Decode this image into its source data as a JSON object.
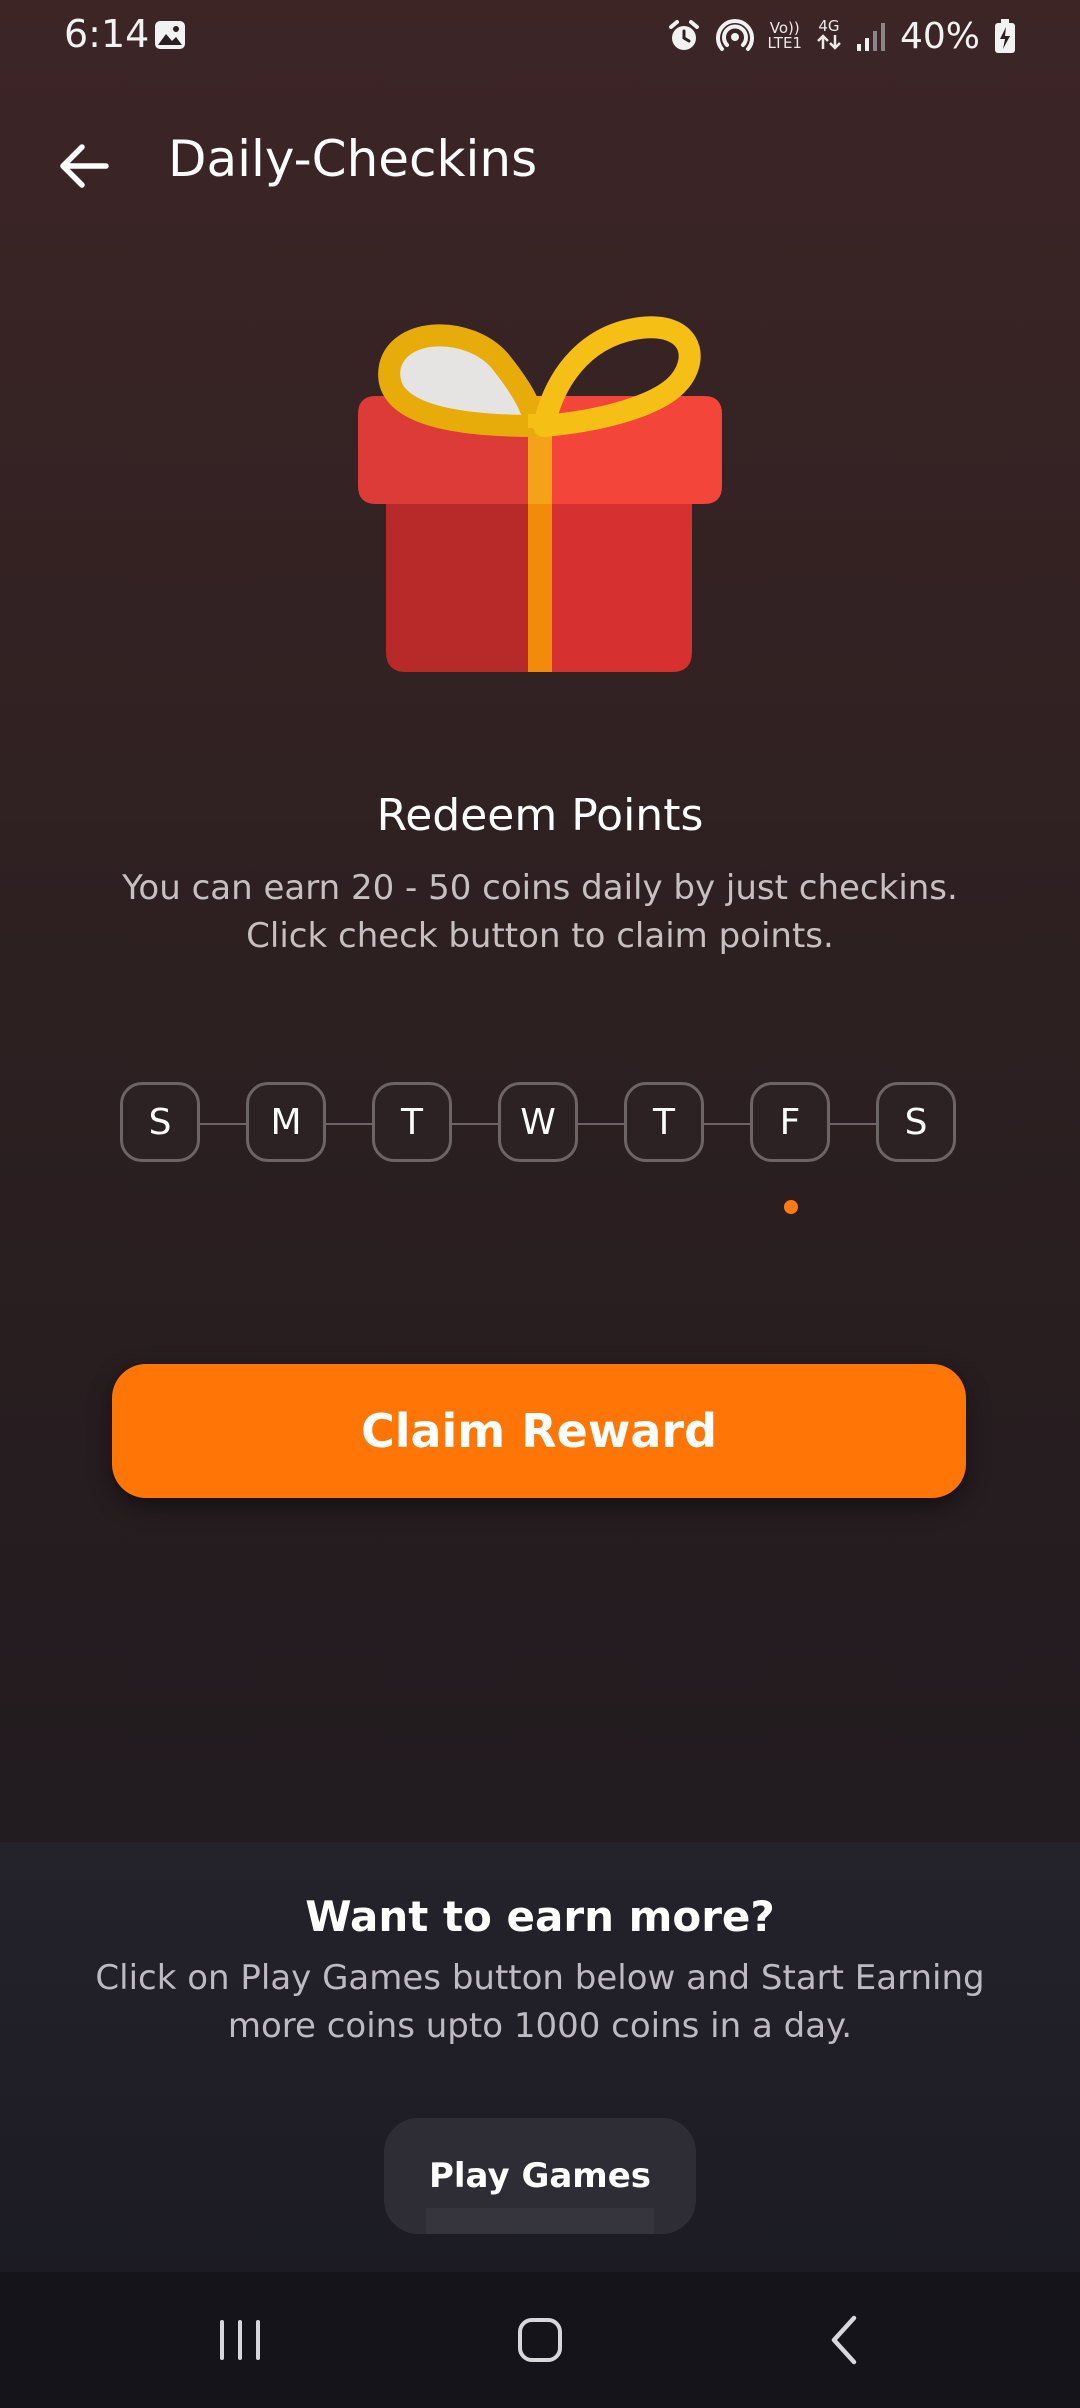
{
  "status_bar": {
    "time": "6:14",
    "network_label_top": "Vo))",
    "network_label_bottom": "LTE1",
    "data_label": "4G",
    "battery": "40%"
  },
  "header": {
    "title": "Daily-Checkins"
  },
  "redeem": {
    "title": "Redeem Points",
    "description": "You can earn 20 - 50 coins daily by just checkins. Click check button to claim points."
  },
  "week": {
    "days": [
      "S",
      "M",
      "T",
      "W",
      "T",
      "F",
      "S"
    ],
    "current_day_index": 5
  },
  "claim_button": {
    "label": "Claim Reward"
  },
  "earn_more": {
    "title": "Want to earn more?",
    "description": "Click on Play Games button below and Start Earning more coins upto 1000 coins in a day.",
    "button_label": "Play Games"
  },
  "colors": {
    "accent": "#ff7606",
    "gift_red": "#e03a36",
    "ribbon_yellow": "#f6bf15"
  }
}
